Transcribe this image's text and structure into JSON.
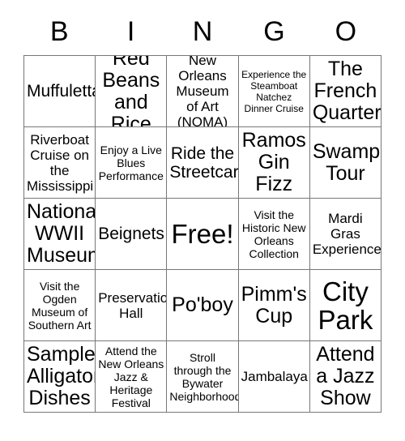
{
  "header": {
    "letters": [
      "B",
      "I",
      "N",
      "G",
      "O"
    ]
  },
  "grid": {
    "rows": [
      [
        {
          "text": "Muffuletta",
          "size": "fs-lg"
        },
        {
          "text": "Red Beans and Rice",
          "size": "fs-xl"
        },
        {
          "text": "New Orleans Museum of Art (NOMA)",
          "size": "fs-md"
        },
        {
          "text": "Experience the Steamboat Natchez Dinner Cruise",
          "size": "fs-xs"
        },
        {
          "text": "The French Quarter",
          "size": "fs-xl"
        }
      ],
      [
        {
          "text": "Riverboat Cruise on the Mississippi",
          "size": "fs-md"
        },
        {
          "text": "Enjoy a Live Blues Performance",
          "size": "fs-sm"
        },
        {
          "text": "Ride the Streetcars",
          "size": "fs-lg"
        },
        {
          "text": "Ramos Gin Fizz",
          "size": "fs-xl"
        },
        {
          "text": "Swamp Tour",
          "size": "fs-xl"
        }
      ],
      [
        {
          "text": "National WWII Museum",
          "size": "fs-xl"
        },
        {
          "text": "Beignets",
          "size": "fs-lg"
        },
        {
          "text": "Free!",
          "size": "fs-xxl"
        },
        {
          "text": "Visit the Historic New Orleans Collection",
          "size": "fs-sm"
        },
        {
          "text": "Mardi Gras Experience",
          "size": "fs-md"
        }
      ],
      [
        {
          "text": "Visit the Ogden Museum of Southern Art",
          "size": "fs-sm"
        },
        {
          "text": "Preservation Hall",
          "size": "fs-md"
        },
        {
          "text": "Po'boy",
          "size": "fs-xl"
        },
        {
          "text": "Pimm's Cup",
          "size": "fs-xl"
        },
        {
          "text": "City Park",
          "size": "fs-xxl"
        }
      ],
      [
        {
          "text": "Sample Alligator Dishes",
          "size": "fs-xl"
        },
        {
          "text": "Attend the New Orleans Jazz & Heritage Festival",
          "size": "fs-sm"
        },
        {
          "text": "Stroll through the Bywater Neighborhood",
          "size": "fs-sm"
        },
        {
          "text": "Jambalaya",
          "size": "fs-md"
        },
        {
          "text": "Attend a Jazz Show",
          "size": "fs-xl"
        }
      ]
    ]
  },
  "colors": {
    "text": "#000000",
    "border": "#777777",
    "background": "#ffffff"
  }
}
